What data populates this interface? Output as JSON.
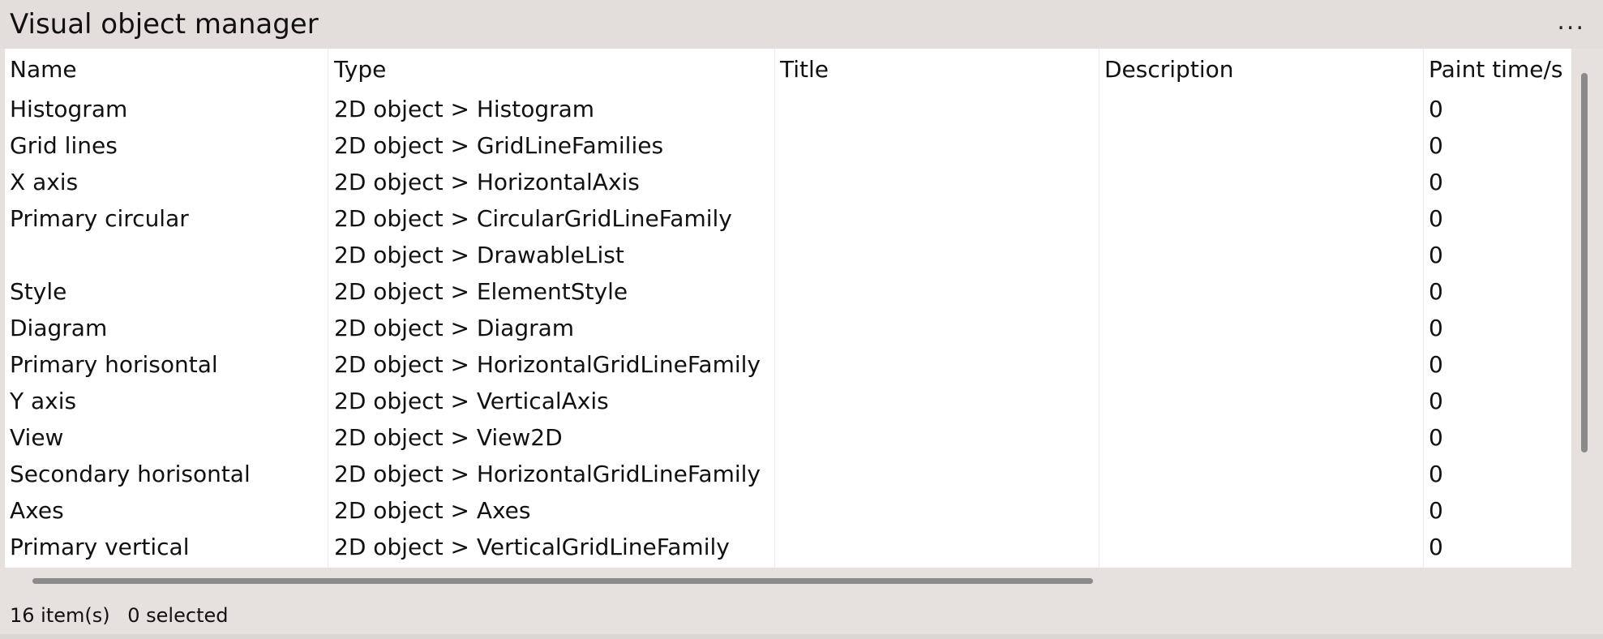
{
  "window": {
    "title": "Visual object manager",
    "more_label": "..."
  },
  "table": {
    "columns": [
      "Name",
      "Type",
      "Title",
      "Description",
      "Paint time/s"
    ],
    "rows": [
      {
        "name": "Histogram",
        "type": "2D object > Histogram",
        "title": "",
        "description": "",
        "paint_time": "0"
      },
      {
        "name": "Grid lines",
        "type": "2D object > GridLineFamilies",
        "title": "",
        "description": "",
        "paint_time": "0"
      },
      {
        "name": "X axis",
        "type": "2D object > HorizontalAxis",
        "title": "",
        "description": "",
        "paint_time": "0"
      },
      {
        "name": "Primary circular",
        "type": "2D object > CircularGridLineFamily",
        "title": "",
        "description": "",
        "paint_time": "0"
      },
      {
        "name": "",
        "type": "2D object > DrawableList",
        "title": "",
        "description": "",
        "paint_time": "0"
      },
      {
        "name": "Style",
        "type": "2D object > ElementStyle",
        "title": "",
        "description": "",
        "paint_time": "0"
      },
      {
        "name": "Diagram",
        "type": "2D object > Diagram",
        "title": "",
        "description": "",
        "paint_time": "0"
      },
      {
        "name": "Primary horisontal",
        "type": "2D object > HorizontalGridLineFamily",
        "title": "",
        "description": "",
        "paint_time": "0"
      },
      {
        "name": "Y axis",
        "type": "2D object > VerticalAxis",
        "title": "",
        "description": "",
        "paint_time": "0"
      },
      {
        "name": "View",
        "type": "2D object > View2D",
        "title": "",
        "description": "",
        "paint_time": "0"
      },
      {
        "name": "Secondary horisontal",
        "type": "2D object > HorizontalGridLineFamily",
        "title": "",
        "description": "",
        "paint_time": "0"
      },
      {
        "name": "Axes",
        "type": "2D object > Axes",
        "title": "",
        "description": "",
        "paint_time": "0"
      },
      {
        "name": "Primary vertical",
        "type": "2D object > VerticalGridLineFamily",
        "title": "",
        "description": "",
        "paint_time": "0"
      }
    ]
  },
  "status": {
    "items": "16 item(s)",
    "selected": "0 selected"
  }
}
